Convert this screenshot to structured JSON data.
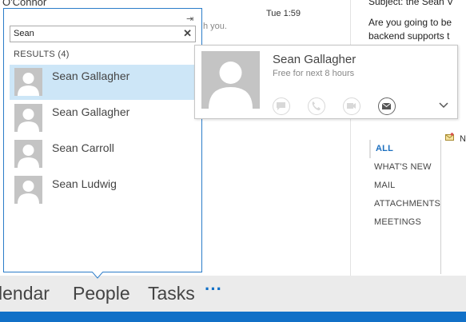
{
  "background": {
    "sender": "O'Connor",
    "time": "Tue 1:59",
    "snippet": "h you.",
    "reading_pane": {
      "line1": "Subject: the Sean V",
      "line2": "Are you going to be",
      "line3": "backend supports t"
    },
    "filters": [
      {
        "label": "ALL",
        "selected": true
      },
      {
        "label": "WHAT'S NEW",
        "selected": false
      },
      {
        "label": "MAIL",
        "selected": false
      },
      {
        "label": "ATTACHMENTS",
        "selected": false
      },
      {
        "label": "MEETINGS",
        "selected": false
      }
    ],
    "flag_letter": "N"
  },
  "nav": {
    "calendar": "lendar",
    "people": "People",
    "tasks": "Tasks",
    "more": "···"
  },
  "search": {
    "value": "Sean",
    "clear": "✕",
    "pin": "⇥",
    "results_heading": "RESULTS (4)",
    "results": [
      {
        "name": "Sean Gallagher",
        "selected": true
      },
      {
        "name": "Sean Gallagher",
        "selected": false
      },
      {
        "name": "Sean Carroll",
        "selected": false
      },
      {
        "name": "Sean Ludwig",
        "selected": false
      }
    ]
  },
  "card": {
    "name": "Sean Gallagher",
    "status": "Free for next 8 hours",
    "actions": [
      "chat-icon",
      "phone-icon",
      "video-icon",
      "mail-icon"
    ],
    "more": "⌄"
  },
  "colors": {
    "accent": "#1170c7",
    "selection": "#cde6f7",
    "avatar_bg": "#c4c4c4",
    "nav_bg": "#ebebeb"
  }
}
